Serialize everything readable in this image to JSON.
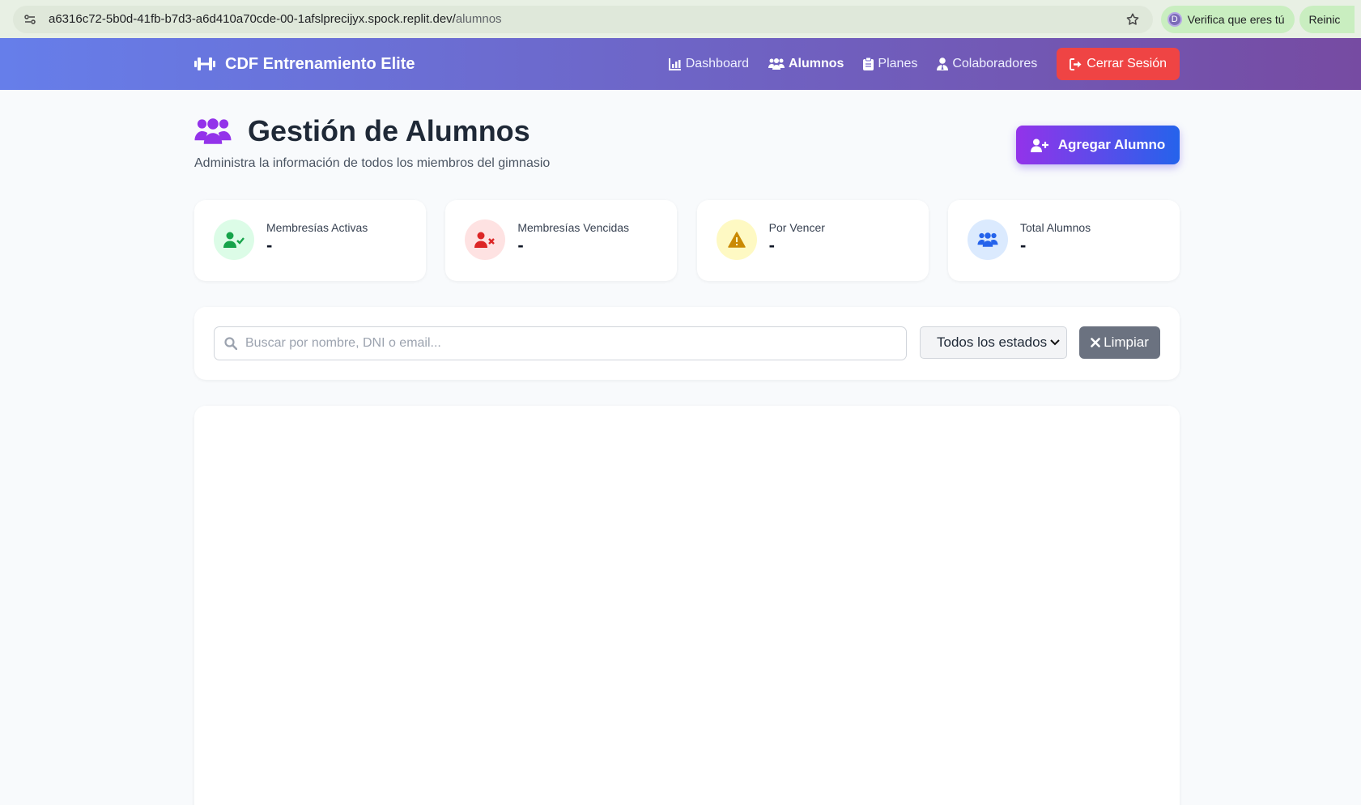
{
  "browser": {
    "url_host": "a6316c72-5b0d-41fb-b7d3-a6d410a70cde-00-1afslprecijyx.spock.replit.dev/",
    "url_path": "alumnos",
    "extension_label": "Verifica que eres tú",
    "extension_avatar": "D",
    "extension2_label": "Reinic"
  },
  "nav": {
    "brand": "CDF Entrenamiento Elite",
    "links": [
      {
        "label": "Dashboard",
        "icon": "chart-icon"
      },
      {
        "label": "Alumnos",
        "icon": "users-icon",
        "active": true
      },
      {
        "label": "Planes",
        "icon": "clipboard-icon"
      },
      {
        "label": "Colaboradores",
        "icon": "user-tie-icon"
      }
    ],
    "logout": "Cerrar Sesión"
  },
  "header": {
    "title": "Gestión de Alumnos",
    "subtitle": "Administra la información de todos los miembros del gimnasio",
    "add_button": "Agregar Alumno"
  },
  "stats": [
    {
      "label": "Membresías Activas",
      "value": "-",
      "icon": "user-check-icon",
      "bg": "#dcfce7",
      "color": "#16a34a"
    },
    {
      "label": "Membresías Vencidas",
      "value": "-",
      "icon": "user-x-icon",
      "bg": "#fee2e2",
      "color": "#dc2626"
    },
    {
      "label": "Por Vencer",
      "value": "-",
      "icon": "warning-icon",
      "bg": "#fef9c3",
      "color": "#ca8a04"
    },
    {
      "label": "Total Alumnos",
      "value": "-",
      "icon": "users-icon",
      "bg": "#dbeafe",
      "color": "#2563eb"
    }
  ],
  "filters": {
    "search_placeholder": "Buscar por nombre, DNI o email...",
    "status_selected": "Todos los estados",
    "clear_button": "Limpiar"
  },
  "colors": {
    "nav_gradient_start": "#667eea",
    "nav_gradient_end": "#764ba2",
    "logout_bg": "#ef4444",
    "title_icon": "#9333ea"
  }
}
